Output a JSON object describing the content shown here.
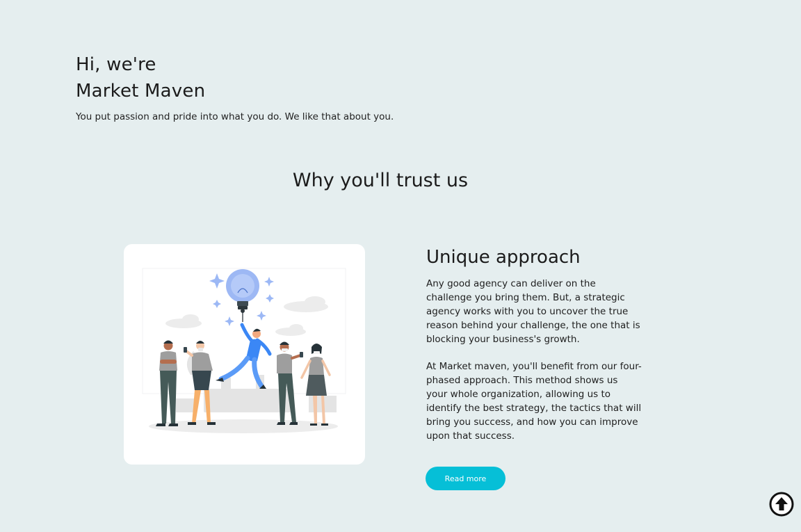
{
  "hero": {
    "line1": "Hi, we're",
    "line2": "Market Maven",
    "tagline": "You put passion and pride into what you do. We like that about you."
  },
  "trust": {
    "title": "Why you'll trust us"
  },
  "feature": {
    "title": "Unique approach",
    "paragraph1": "Any good agency can deliver on the challenge you bring them. But, a strategic agency works with you to uncover the true reason behind your challenge, the one that is blocking your business's growth.",
    "paragraph2": "At Market maven, you'll benefit from our four-phased approach. This method shows us your whole organization, allowing us to identify the best strategy, the tactics that will bring you success, and how you can improve upon that success.",
    "button_label": "Read more"
  },
  "colors": {
    "background": "#e5eeef",
    "accent": "#06bfd7",
    "text": "#1b1b1b"
  },
  "icons": {
    "scroll_top": "arrow-up-circle-icon",
    "illustration": "team-lightbulb-illustration"
  }
}
